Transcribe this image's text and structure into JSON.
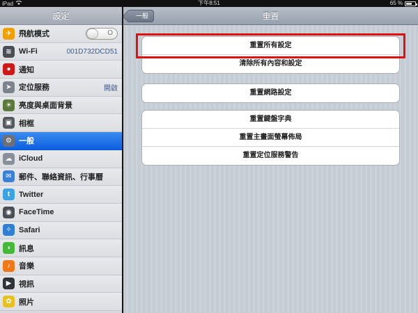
{
  "status_bar": {
    "device": "iPad",
    "time": "下午8:51",
    "battery": "65 %",
    "battery_level": 0.65
  },
  "sidebar": {
    "title": "設定",
    "items": [
      {
        "label": "飛航模式",
        "icon": "airplane-icon",
        "color": "#f0a000",
        "toggle": "O"
      },
      {
        "label": "Wi-Fi",
        "icon": "wifi-icon",
        "color": "#4a4f57",
        "value": "001D732DCD51"
      },
      {
        "label": "通知",
        "icon": "notifications-icon",
        "color": "#d01818"
      },
      {
        "label": "定位服務",
        "icon": "location-icon",
        "color": "#7d838c",
        "value": "開啟"
      },
      {
        "label": "亮度與桌面背景",
        "icon": "brightness-icon",
        "color": "#5a7a3a"
      },
      {
        "label": "相框",
        "icon": "picture-frame-icon",
        "color": "#555a60"
      },
      {
        "label": "一般",
        "icon": "gear-icon",
        "color": "#6b7078",
        "selected": true
      },
      {
        "label": "iCloud",
        "icon": "cloud-icon",
        "color": "#8a9099"
      },
      {
        "label": "郵件、聯絡資訊、行事曆",
        "icon": "mail-icon",
        "color": "#3a7fd8"
      },
      {
        "label": "Twitter",
        "icon": "twitter-icon",
        "color": "#3aa3e3"
      },
      {
        "label": "FaceTime",
        "icon": "facetime-icon",
        "color": "#4a4f57"
      },
      {
        "label": "Safari",
        "icon": "safari-icon",
        "color": "#2f7fd5"
      },
      {
        "label": "訊息",
        "icon": "messages-icon",
        "color": "#45b83a"
      },
      {
        "label": "音樂",
        "icon": "music-icon",
        "color": "#f07818"
      },
      {
        "label": "視訊",
        "icon": "video-icon",
        "color": "#303438"
      },
      {
        "label": "照片",
        "icon": "photos-icon",
        "color": "#e8c020"
      }
    ]
  },
  "navbar": {
    "back_label": "一般",
    "title": "重置"
  },
  "groups": [
    {
      "cells": [
        "重置所有設定",
        "清除所有內容和設定"
      ]
    },
    {
      "cells": [
        "重置網路設定"
      ]
    },
    {
      "cells": [
        "重置鍵盤字典",
        "重置主畫面螢幕佈局",
        "重置定位服務警告"
      ]
    }
  ],
  "colors": {
    "selection": "#1f74e8",
    "highlight_border": "#e01010"
  }
}
